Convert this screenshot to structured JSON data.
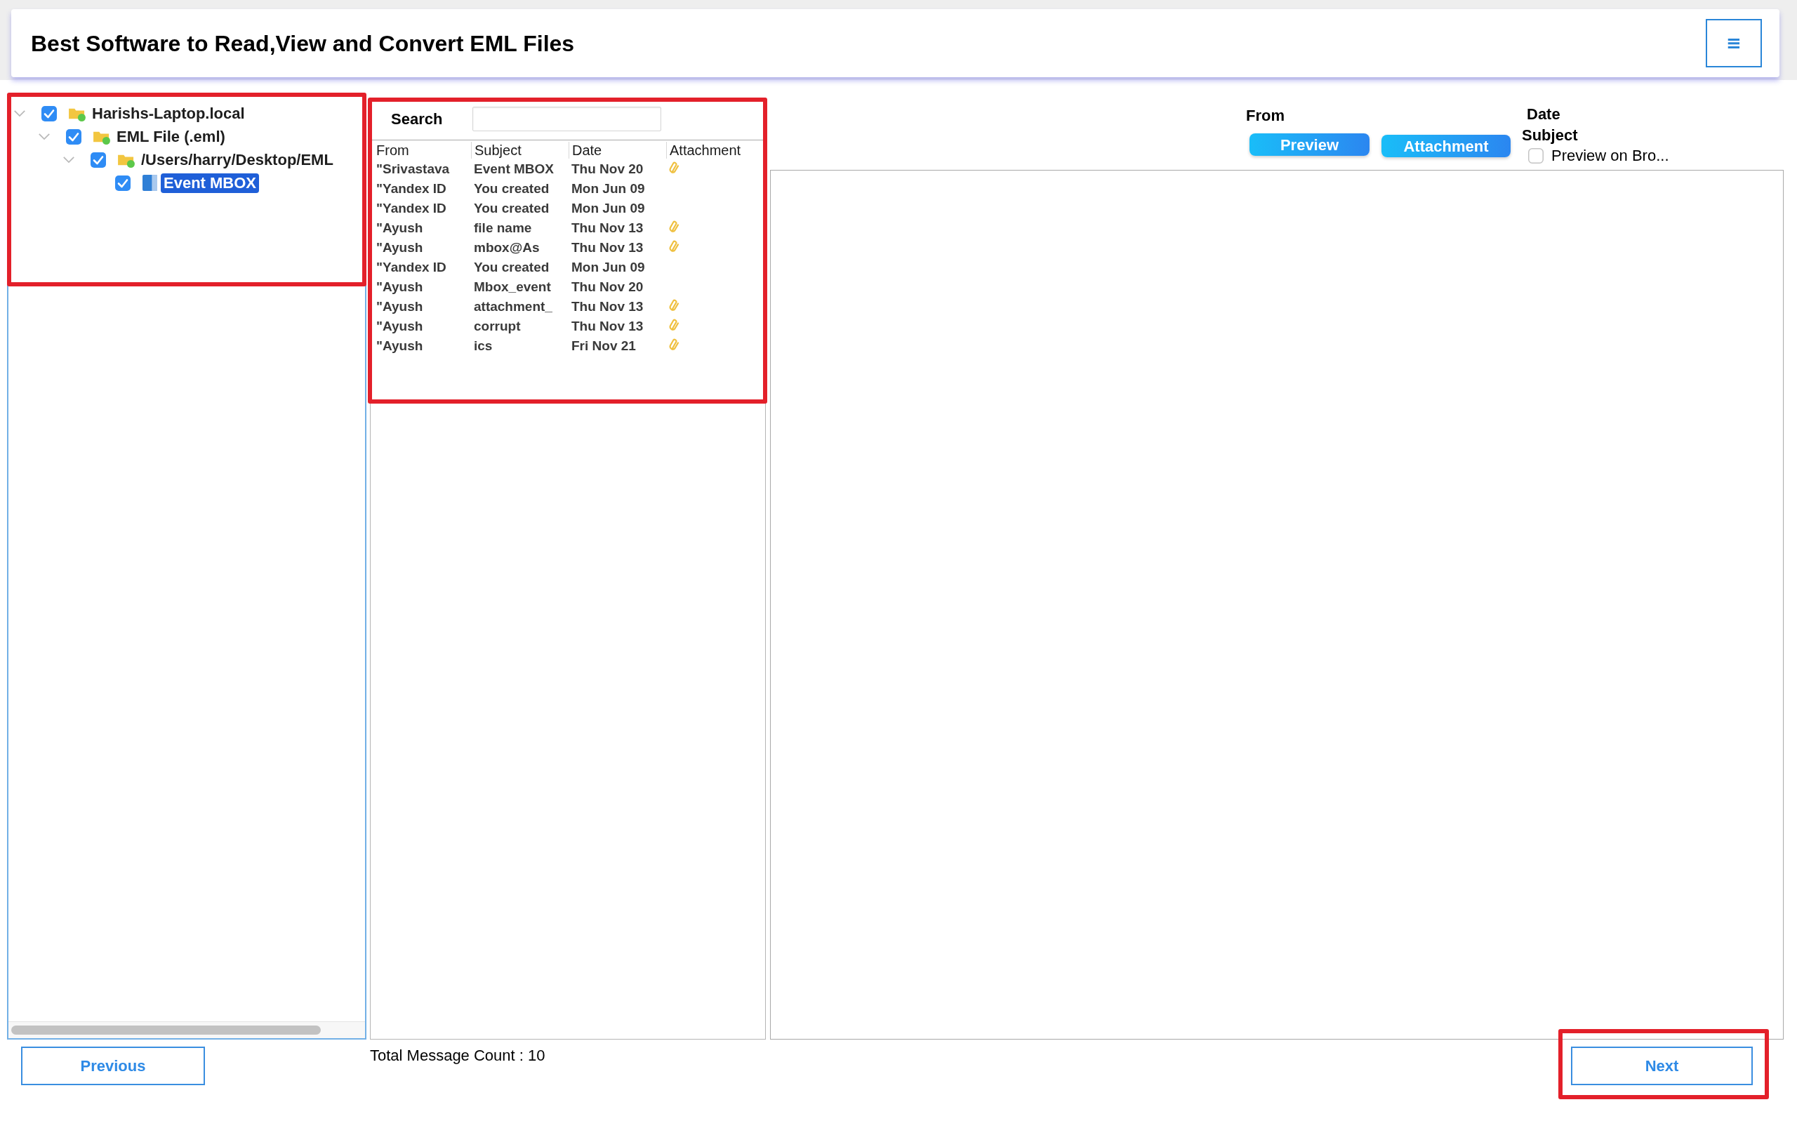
{
  "header": {
    "title": "Best Software to Read,View and Convert EML Files",
    "menu_button": "≡"
  },
  "tree": {
    "highlighted": true,
    "items": [
      {
        "label": "Harishs-Laptop.local",
        "kind": "folder",
        "checked": true,
        "expanded": true,
        "selected": false,
        "children": [
          {
            "label": "EML File (.eml)",
            "kind": "folder",
            "checked": true,
            "expanded": true,
            "selected": false,
            "children": [
              {
                "label": "/Users/harry/Desktop/EML",
                "kind": "folder",
                "checked": true,
                "expanded": true,
                "selected": false,
                "children": [
                  {
                    "label": "Event MBOX",
                    "kind": "mailbox",
                    "checked": true,
                    "selected": true
                  }
                ]
              }
            ]
          }
        ]
      }
    ]
  },
  "message_list": {
    "highlighted": true,
    "search": {
      "label": "Search"
    },
    "columns": [
      "From",
      "Subject",
      "Date",
      "Attachment"
    ],
    "rows": [
      {
        "from": "\"Srivastava",
        "subject": "Event MBOX",
        "date": "Thu Nov 20",
        "attachment": true
      },
      {
        "from": "\"Yandex ID",
        "subject": "You created",
        "date": "Mon Jun 09",
        "attachment": false
      },
      {
        "from": "\"Yandex ID",
        "subject": "You created",
        "date": "Mon Jun 09",
        "attachment": false
      },
      {
        "from": "\"Ayush",
        "subject": "file name",
        "date": "Thu Nov 13",
        "attachment": true
      },
      {
        "from": "\"Ayush",
        "subject": "mbox@As",
        "date": "Thu Nov 13",
        "attachment": true
      },
      {
        "from": "\"Yandex ID",
        "subject": "You created",
        "date": "Mon Jun 09",
        "attachment": false
      },
      {
        "from": "\"Ayush",
        "subject": "Mbox_event",
        "date": "Thu Nov 20",
        "attachment": false
      },
      {
        "from": "\"Ayush",
        "subject": "attachment_",
        "date": "Thu Nov 13",
        "attachment": true
      },
      {
        "from": "\"Ayush",
        "subject": "corrupt",
        "date": "Thu Nov 13",
        "attachment": true
      },
      {
        "from": "\"Ayush",
        "subject": "ics",
        "date": "Fri Nov 21",
        "attachment": true
      }
    ]
  },
  "message_count": "Total Message Count : 10",
  "preview_panel": {
    "from_label": "From",
    "date_label": "Date",
    "subject_label": "Subject",
    "buttons": [
      "Preview",
      "Attachment"
    ],
    "browser_preview": {
      "label": "Preview on Bro...",
      "checked": false
    }
  },
  "footer": {
    "previous": {
      "label": "Previous",
      "highlighted": false
    },
    "next": {
      "label": "Next",
      "highlighted": true
    }
  }
}
